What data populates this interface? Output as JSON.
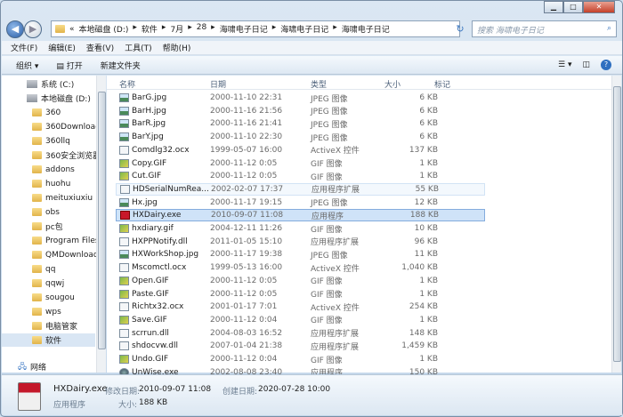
{
  "address": {
    "crumbs": [
      "本地磁盘 (D:)",
      "软件",
      "7月",
      "28",
      "海啸电子日记",
      "海啸电子日记",
      "海啸电子日记"
    ],
    "prefix": "«"
  },
  "search": {
    "placeholder": "搜索 海啸电子日记"
  },
  "menu": [
    "文件(F)",
    "编辑(E)",
    "查看(V)",
    "工具(T)",
    "帮助(H)"
  ],
  "toolbar": {
    "organize": "组织 ▾",
    "open": "打开",
    "new_folder": "新建文件夹"
  },
  "sidebar": {
    "items": [
      {
        "label": "系统 (C:)",
        "icon": "drive"
      },
      {
        "label": "本地磁盘 (D:)",
        "icon": "drive"
      },
      {
        "label": "360",
        "icon": "folder"
      },
      {
        "label": "360Downloads",
        "icon": "folder"
      },
      {
        "label": "360llq",
        "icon": "folder"
      },
      {
        "label": "360安全浏览器",
        "icon": "folder"
      },
      {
        "label": "addons",
        "icon": "folder"
      },
      {
        "label": "huohu",
        "icon": "folder"
      },
      {
        "label": "meituxiuxiu",
        "icon": "folder"
      },
      {
        "label": "obs",
        "icon": "folder"
      },
      {
        "label": "pc包",
        "icon": "folder"
      },
      {
        "label": "Program Files",
        "icon": "folder"
      },
      {
        "label": "QMDownload",
        "icon": "folder"
      },
      {
        "label": "qq",
        "icon": "folder"
      },
      {
        "label": "qqwj",
        "icon": "folder"
      },
      {
        "label": "sougou",
        "icon": "folder"
      },
      {
        "label": "wps",
        "icon": "folder"
      },
      {
        "label": "电脑管家",
        "icon": "folder"
      },
      {
        "label": "软件",
        "icon": "folder",
        "selected": true
      }
    ],
    "network": "网络"
  },
  "columns": {
    "name": "名称",
    "date": "日期",
    "type": "类型",
    "size": "大小",
    "tags": "标记"
  },
  "files": [
    {
      "name": "BarG.jpg",
      "date": "2000-11-10 22:31",
      "type": "JPEG 图像",
      "size": "6 KB",
      "icon": "img"
    },
    {
      "name": "BarH.jpg",
      "date": "2000-11-16 21:56",
      "type": "JPEG 图像",
      "size": "6 KB",
      "icon": "img"
    },
    {
      "name": "BarR.jpg",
      "date": "2000-11-16 21:41",
      "type": "JPEG 图像",
      "size": "6 KB",
      "icon": "img"
    },
    {
      "name": "BarY.jpg",
      "date": "2000-11-10 22:30",
      "type": "JPEG 图像",
      "size": "6 KB",
      "icon": "img"
    },
    {
      "name": "Comdlg32.ocx",
      "date": "1999-05-07 16:00",
      "type": "ActiveX 控件",
      "size": "137 KB",
      "icon": "dll"
    },
    {
      "name": "Copy.GIF",
      "date": "2000-11-12 0:05",
      "type": "GIF 图像",
      "size": "1 KB",
      "icon": "gif"
    },
    {
      "name": "Cut.GIF",
      "date": "2000-11-12 0:05",
      "type": "GIF 图像",
      "size": "1 KB",
      "icon": "gif"
    },
    {
      "name": "HDSerialNumRea...",
      "date": "2002-02-07 17:37",
      "type": "应用程序扩展",
      "size": "55 KB",
      "icon": "dll",
      "state": "hover"
    },
    {
      "name": "Hx.jpg",
      "date": "2000-11-17 19:15",
      "type": "JPEG 图像",
      "size": "12 KB",
      "icon": "img"
    },
    {
      "name": "HXDairy.exe",
      "date": "2010-09-07 11:08",
      "type": "应用程序",
      "size": "188 KB",
      "icon": "exe",
      "state": "selected"
    },
    {
      "name": "hxdiary.gif",
      "date": "2004-12-11 11:26",
      "type": "GIF 图像",
      "size": "10 KB",
      "icon": "gif"
    },
    {
      "name": "HXPPNotify.dll",
      "date": "2011-01-05 15:10",
      "type": "应用程序扩展",
      "size": "96 KB",
      "icon": "dll"
    },
    {
      "name": "HXWorkShop.jpg",
      "date": "2000-11-17 19:38",
      "type": "JPEG 图像",
      "size": "11 KB",
      "icon": "img"
    },
    {
      "name": "Mscomctl.ocx",
      "date": "1999-05-13 16:00",
      "type": "ActiveX 控件",
      "size": "1,040 KB",
      "icon": "dll"
    },
    {
      "name": "Open.GIF",
      "date": "2000-11-12 0:05",
      "type": "GIF 图像",
      "size": "1 KB",
      "icon": "gif"
    },
    {
      "name": "Paste.GIF",
      "date": "2000-11-12 0:05",
      "type": "GIF 图像",
      "size": "1 KB",
      "icon": "gif"
    },
    {
      "name": "Richtx32.ocx",
      "date": "2001-01-17 7:01",
      "type": "ActiveX 控件",
      "size": "254 KB",
      "icon": "dll"
    },
    {
      "name": "Save.GIF",
      "date": "2000-11-12 0:04",
      "type": "GIF 图像",
      "size": "1 KB",
      "icon": "gif"
    },
    {
      "name": "scrrun.dll",
      "date": "2004-08-03 16:52",
      "type": "应用程序扩展",
      "size": "148 KB",
      "icon": "dll"
    },
    {
      "name": "shdocvw.dll",
      "date": "2007-01-04 21:38",
      "type": "应用程序扩展",
      "size": "1,459 KB",
      "icon": "dll"
    },
    {
      "name": "Undo.GIF",
      "date": "2000-11-12 0:04",
      "type": "GIF 图像",
      "size": "1 KB",
      "icon": "gif"
    },
    {
      "name": "UnWise.exe",
      "date": "2002-08-08 23:40",
      "type": "应用程序",
      "size": "150 KB",
      "icon": "wise"
    }
  ],
  "details": {
    "name": "HXDairy.exe",
    "type": "应用程序",
    "modified_label": "修改日期:",
    "modified": "2010-09-07 11:08",
    "created_label": "创建日期:",
    "created": "2020-07-28 10:00",
    "size_label": "大小:",
    "size": "188 KB"
  }
}
